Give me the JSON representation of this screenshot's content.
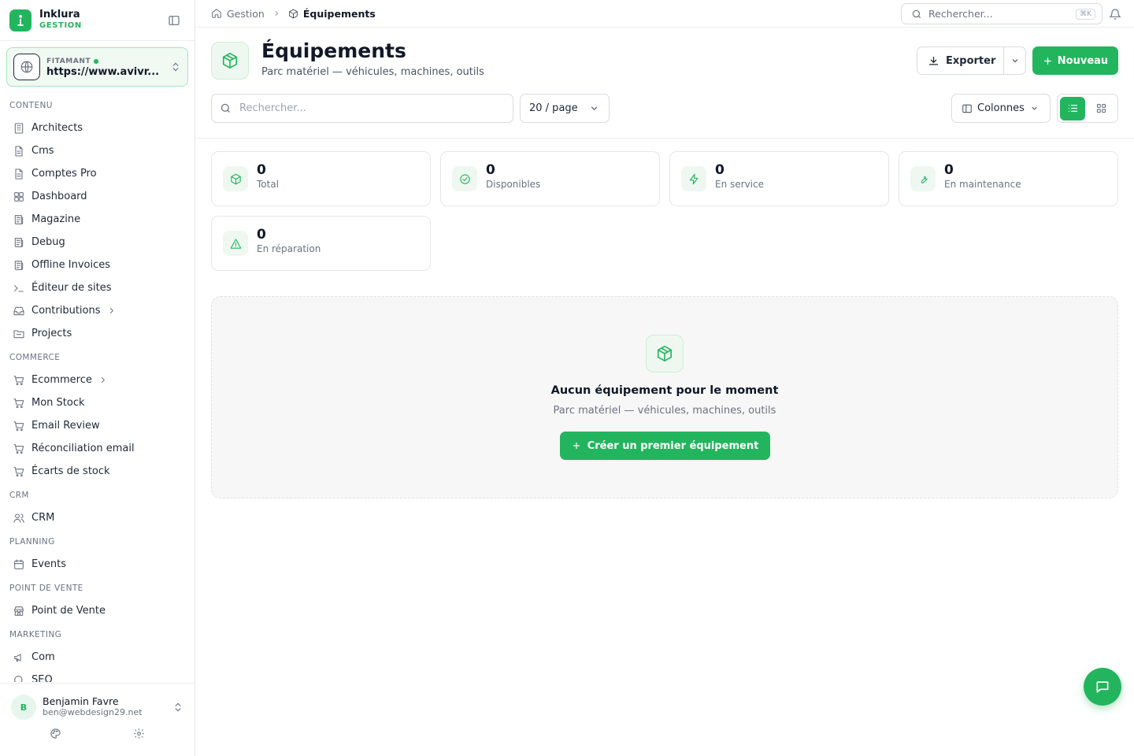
{
  "brand": {
    "name": "Inklura",
    "subtitle": "GESTION"
  },
  "site": {
    "label": "FITAMANT",
    "url": "https://www.avivr..."
  },
  "sidebar": {
    "sections": [
      {
        "title": "CONTENU",
        "items": [
          {
            "label": "Architects",
            "icon": "building-icon"
          },
          {
            "label": "Cms",
            "icon": "file-icon"
          },
          {
            "label": "Comptes Pro",
            "icon": "file-icon"
          },
          {
            "label": "Dashboard",
            "icon": "layout-grid-icon"
          },
          {
            "label": "Magazine",
            "icon": "newspaper-icon"
          },
          {
            "label": "Debug",
            "icon": "newspaper-icon"
          },
          {
            "label": "Offline Invoices",
            "icon": "newspaper-icon"
          },
          {
            "label": "Éditeur de sites",
            "icon": "terminal-icon"
          },
          {
            "label": "Contributions",
            "icon": "inbox-icon",
            "has_children": true
          },
          {
            "label": "Projects",
            "icon": "folder-icon"
          }
        ]
      },
      {
        "title": "COMMERCE",
        "items": [
          {
            "label": "Ecommerce",
            "icon": "cart-icon",
            "has_children": true
          },
          {
            "label": "Mon Stock",
            "icon": "cart-icon"
          },
          {
            "label": "Email Review",
            "icon": "cart-icon"
          },
          {
            "label": "Réconciliation email",
            "icon": "cart-icon"
          },
          {
            "label": "Écarts de stock",
            "icon": "cart-icon"
          }
        ]
      },
      {
        "title": "CRM",
        "items": [
          {
            "label": "CRM",
            "icon": "users-icon"
          }
        ]
      },
      {
        "title": "PLANNING",
        "items": [
          {
            "label": "Events",
            "icon": "calendar-icon"
          }
        ]
      },
      {
        "title": "POINT DE VENTE",
        "items": [
          {
            "label": "Point de Vente",
            "icon": "store-icon"
          }
        ]
      },
      {
        "title": "MARKETING",
        "items": [
          {
            "label": "Com",
            "icon": "megaphone-icon"
          },
          {
            "label": "SEO",
            "icon": "search-icon"
          }
        ]
      }
    ]
  },
  "user": {
    "initial": "B",
    "name": "Benjamin Favre",
    "email": "ben@webdesign29.net"
  },
  "breadcrumb": {
    "root": "Gestion",
    "current": "Équipements"
  },
  "topbar": {
    "search_placeholder": "Rechercher...",
    "shortcut": "⌘K"
  },
  "header": {
    "title": "Équipements",
    "subtitle": "Parc matériel — véhicules, machines, outils",
    "export_label": "Exporter",
    "new_label": "Nouveau"
  },
  "toolbar": {
    "search_placeholder": "Rechercher...",
    "page_size": "20 / page",
    "columns_label": "Colonnes",
    "view": "list"
  },
  "stats": [
    {
      "value": "0",
      "label": "Total",
      "icon": "box-icon"
    },
    {
      "value": "0",
      "label": "Disponibles",
      "icon": "check-circle-icon"
    },
    {
      "value": "0",
      "label": "En service",
      "icon": "zap-icon"
    },
    {
      "value": "0",
      "label": "En maintenance",
      "icon": "wrench-icon"
    },
    {
      "value": "0",
      "label": "En réparation",
      "icon": "alert-triangle-icon"
    }
  ],
  "empty": {
    "title": "Aucun équipement pour le moment",
    "subtitle": "Parc matériel — véhicules, machines, outils",
    "cta": "Créer un premier équipement"
  },
  "colors": {
    "accent": "#22b55e",
    "accent_soft": "#eef8f1",
    "border": "#e5e7eb",
    "text": "#111827",
    "muted": "#6b7280"
  }
}
